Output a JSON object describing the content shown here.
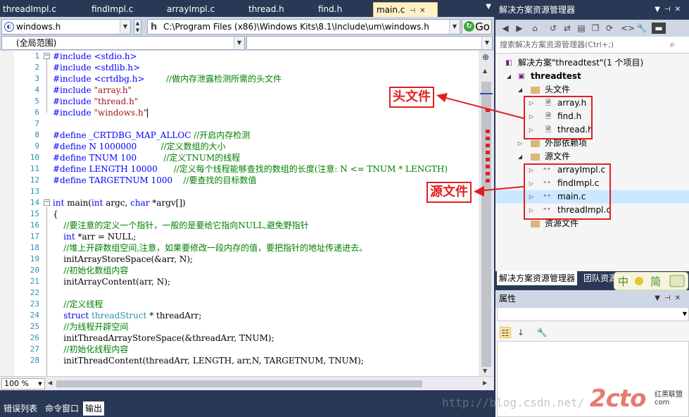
{
  "editor_tabs": [
    {
      "label": "threadImpl.c",
      "active": false
    },
    {
      "label": "findImpl.c",
      "active": false
    },
    {
      "label": "arrayImpl.c",
      "active": false
    },
    {
      "label": "thread.h",
      "active": false
    },
    {
      "label": "find.h",
      "active": false
    },
    {
      "label": "main.c",
      "active": true
    }
  ],
  "nav": {
    "project_combo": "windows.h",
    "path_combo": "C:\\Program Files (x86)\\Windows Kits\\8.1\\Include\\um\\windows.h",
    "go_label": "Go",
    "scope_combo": "(全局范围)"
  },
  "code": {
    "line_numbers": [
      "1",
      "2",
      "3",
      "4",
      "5",
      "6",
      "7",
      "8",
      "9",
      "10",
      "11",
      "12",
      "13",
      "14",
      "15",
      "16",
      "17",
      "18",
      "19",
      "20",
      "21",
      "22",
      "23",
      "24",
      "25",
      "26",
      "27",
      "28"
    ],
    "lines": {
      "l1": "#include <stdio.h>",
      "l2": "#include <stdlib.h>",
      "l3a": "#include <crtdbg.h>",
      "l3b": "        //做内存泄露检测所需的头文件",
      "l4a": "#include ",
      "l4b": "\"array.h\"",
      "l5a": "#include ",
      "l5b": "\"thread.h\"",
      "l6a": "#include ",
      "l6b": "\"windows.h\"",
      "l8a": "#define _CRTDBG_MAP_ALLOC ",
      "l8b": "//开启内存检测",
      "l9a": "#define N 1000000         ",
      "l9b": "//定义数组的大小",
      "l10a": "#define TNUM 100          ",
      "l10b": "//定义TNUM的线程",
      "l11a": "#define LENGTH 10000      ",
      "l11b": "//定义每个线程能够查找的数组的长度(注意: N <= TNUM * LENGTH)",
      "l12a": "#define TARGETNUM 1000    ",
      "l12b": "//要查找的目标数值",
      "l14a": "int",
      "l14b": " main(",
      "l14c": "int",
      "l14d": " argc, ",
      "l14e": "char",
      "l14f": " *argv[])",
      "l15": "{",
      "l16": "    //要注意的定义一个指针，一般的是要给它指向NULL,避免野指针",
      "l17a": "    ",
      "l17b": "int",
      "l17c": " *arr = NULL;",
      "l18": "    //堆上开辟数组空间,注意，如果要修改一段内存的值，要把指针的地址传递进去。",
      "l19": "    initArrayStoreSpace(&arr, N);",
      "l20": "    //初始化数组内容",
      "l21": "    initArrayContent(arr, N);",
      "l23": "    //定义线程",
      "l24a": "    ",
      "l24b": "struct",
      "l24c": " ",
      "l24d": "threadStruct",
      "l24e": " * threadArr;",
      "l25": "    //为线程开辟空间",
      "l26": "    initThreadArrayStoreSpace(&threadArr, TNUM);",
      "l27": "    //初始化线程内容",
      "l28": "    initThreadContent(threadArr, LENGTH, arr,N, TARGETNUM, TNUM);"
    }
  },
  "zoom": "100 %",
  "bottom_tabs": [
    {
      "label": "错误列表",
      "active": false
    },
    {
      "label": "命令窗口",
      "active": false
    },
    {
      "label": "输出",
      "active": true
    }
  ],
  "solution_explorer": {
    "title": "解决方案资源管理器",
    "search_placeholder": "搜索解决方案资源管理器(Ctrl+;)",
    "solution_label": "解决方案\"threadtest\"(1 个项目)",
    "project_label": "threadtest",
    "header_folder": "头文件",
    "header_files": [
      "array.h",
      "find.h",
      "thread.h"
    ],
    "external_deps": "外部依赖项",
    "source_folder": "源文件",
    "source_files": [
      "arrayImpl.c",
      "findImpl.c",
      "main.c",
      "threadImpl.c"
    ],
    "resource_folder": "资源文件",
    "tabs": [
      "解决方案资源管理器",
      "团队资源"
    ]
  },
  "properties": {
    "title": "属性"
  },
  "annotations": {
    "headers_callout": "头文件",
    "sources_callout": "源文件",
    "color": "#e02020"
  },
  "watermark": {
    "url": "http://blog.csdn.net/",
    "logo": "2cto",
    "sub1": "红黑联盟",
    "sub2": "com",
    "badge": "中简"
  }
}
